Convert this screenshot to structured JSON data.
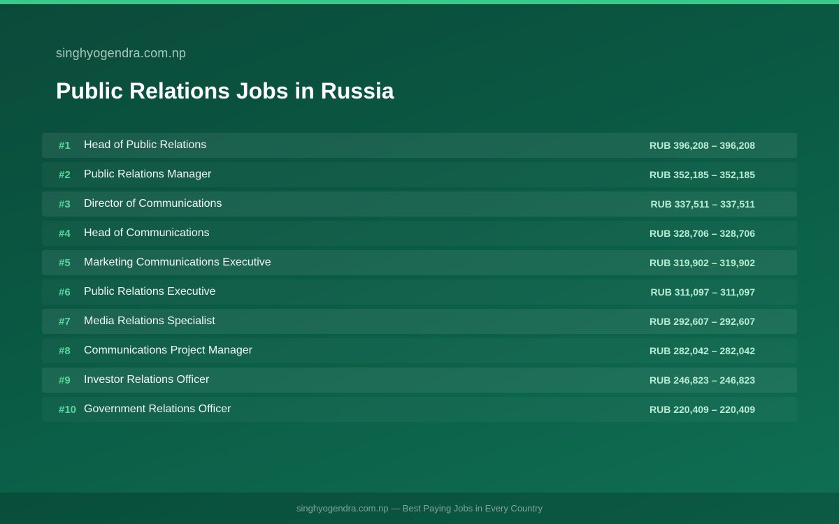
{
  "header": {
    "site_name": "singhyogendra.com.np",
    "title": "Public Relations Jobs in Russia"
  },
  "jobs": [
    {
      "rank": "#1",
      "title": "Head of Public Relations",
      "salary": "RUB 396,208 – 396,208"
    },
    {
      "rank": "#2",
      "title": "Public Relations Manager",
      "salary": "RUB 352,185 – 352,185"
    },
    {
      "rank": "#3",
      "title": "Director of Communications",
      "salary": "RUB 337,511 – 337,511"
    },
    {
      "rank": "#4",
      "title": "Head of Communications",
      "salary": "RUB 328,706 – 328,706"
    },
    {
      "rank": "#5",
      "title": "Marketing Communications Executive",
      "salary": "RUB 319,902 – 319,902"
    },
    {
      "rank": "#6",
      "title": "Public Relations Executive",
      "salary": "RUB 311,097 – 311,097"
    },
    {
      "rank": "#7",
      "title": "Media Relations Specialist",
      "salary": "RUB 292,607 – 292,607"
    },
    {
      "rank": "#8",
      "title": "Communications Project Manager",
      "salary": "RUB 282,042 – 282,042"
    },
    {
      "rank": "#9",
      "title": "Investor Relations Officer",
      "salary": "RUB 246,823 – 246,823"
    },
    {
      "rank": "#10",
      "title": "Government Relations Officer",
      "salary": "RUB 220,409 – 220,409"
    }
  ],
  "footer": {
    "text": "singhyogendra.com.np — Best Paying Jobs in Every Country"
  },
  "colors": {
    "accent": "#39c98a",
    "rank": "#56d79c",
    "salary": "#b8ecd3",
    "background": "#0a5a44"
  }
}
